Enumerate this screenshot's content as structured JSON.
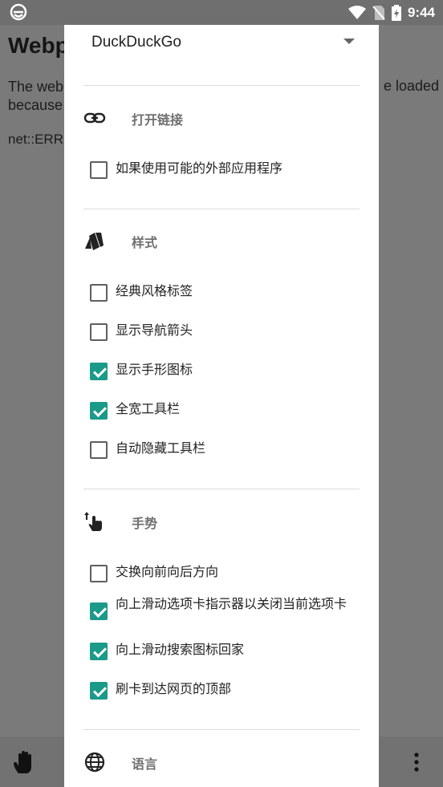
{
  "status_bar": {
    "time": "9:44"
  },
  "background_page": {
    "title": "Webp",
    "text_left": "The web because",
    "text_right": "e loaded",
    "error": "net::ERR"
  },
  "dialog": {
    "dropdown": {
      "value": "DuckDuckGo"
    },
    "sections": [
      {
        "title": "打开链接",
        "icon": "link-icon",
        "options": [
          {
            "label": "如果使用可能的外部应用程序",
            "checked": false
          }
        ]
      },
      {
        "title": "样式",
        "icon": "palette-icon",
        "options": [
          {
            "label": "经典风格标签",
            "checked": false
          },
          {
            "label": "显示导航箭头",
            "checked": false
          },
          {
            "label": "显示手形图标",
            "checked": true
          },
          {
            "label": "全宽工具栏",
            "checked": true
          },
          {
            "label": "自动隐藏工具栏",
            "checked": false
          }
        ]
      },
      {
        "title": "手势",
        "icon": "swipe-gesture-icon",
        "options": [
          {
            "label": "交换向前向后方向",
            "checked": false
          },
          {
            "label": "向上滑动选项卡指示器以关闭当前选项卡",
            "checked": true
          },
          {
            "label": "向上滑动搜索图标回家",
            "checked": true
          },
          {
            "label": "刷卡到达网页的顶部",
            "checked": true
          }
        ]
      },
      {
        "title": "语言",
        "icon": "globe-icon",
        "options": []
      }
    ]
  },
  "colors": {
    "accent": "#1b9a8a",
    "scrim": "#7a7a7a"
  }
}
